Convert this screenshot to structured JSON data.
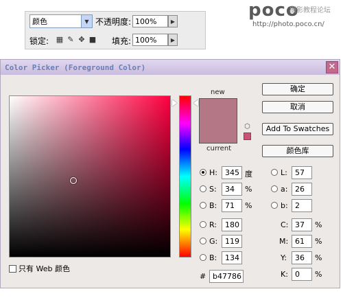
{
  "layers_panel": {
    "blend_mode": "颜色",
    "opacity_label": "不透明度:",
    "opacity_value": "100%",
    "lock_label": "锁定:",
    "fill_label": "填充:",
    "fill_value": "100%"
  },
  "watermark": {
    "logo": "poco",
    "caption": "摄影教程论坛",
    "url": "http://photo.poco.cn/"
  },
  "dialog": {
    "title": "Color Picker (Foreground Color)",
    "close": "✕",
    "new_label": "new",
    "current_label": "current",
    "web_only_label": "只有 Web 颜色",
    "new_color": "#b47786",
    "current_color": "#b47786",
    "gamut_color": "#c8547a",
    "buttons": {
      "ok": "确定",
      "cancel": "取消",
      "add_swatches": "Add To Swatches",
      "libraries": "颜色库"
    },
    "hsb": {
      "h_label": "H:",
      "h_value": "345",
      "h_unit": "度",
      "s_label": "S:",
      "s_value": "34",
      "s_unit": "%",
      "b_label": "B:",
      "b_value": "71",
      "b_unit": "%"
    },
    "rgb": {
      "r_label": "R:",
      "r_value": "180",
      "g_label": "G:",
      "g_value": "119",
      "b_label": "B:",
      "b_value": "134"
    },
    "lab": {
      "l_label": "L:",
      "l_value": "57",
      "a_label": "a:",
      "a_value": "26",
      "b_label": "b:",
      "b_value": "2"
    },
    "cmyk": {
      "c_label": "C:",
      "c_value": "37",
      "c_unit": "%",
      "m_label": "M:",
      "m_value": "61",
      "m_unit": "%",
      "y_label": "Y:",
      "y_value": "36",
      "y_unit": "%",
      "k_label": "K:",
      "k_value": "0",
      "k_unit": "%"
    },
    "hex_label": "#",
    "hex_value": "b47786",
    "selected_mode": "H"
  }
}
